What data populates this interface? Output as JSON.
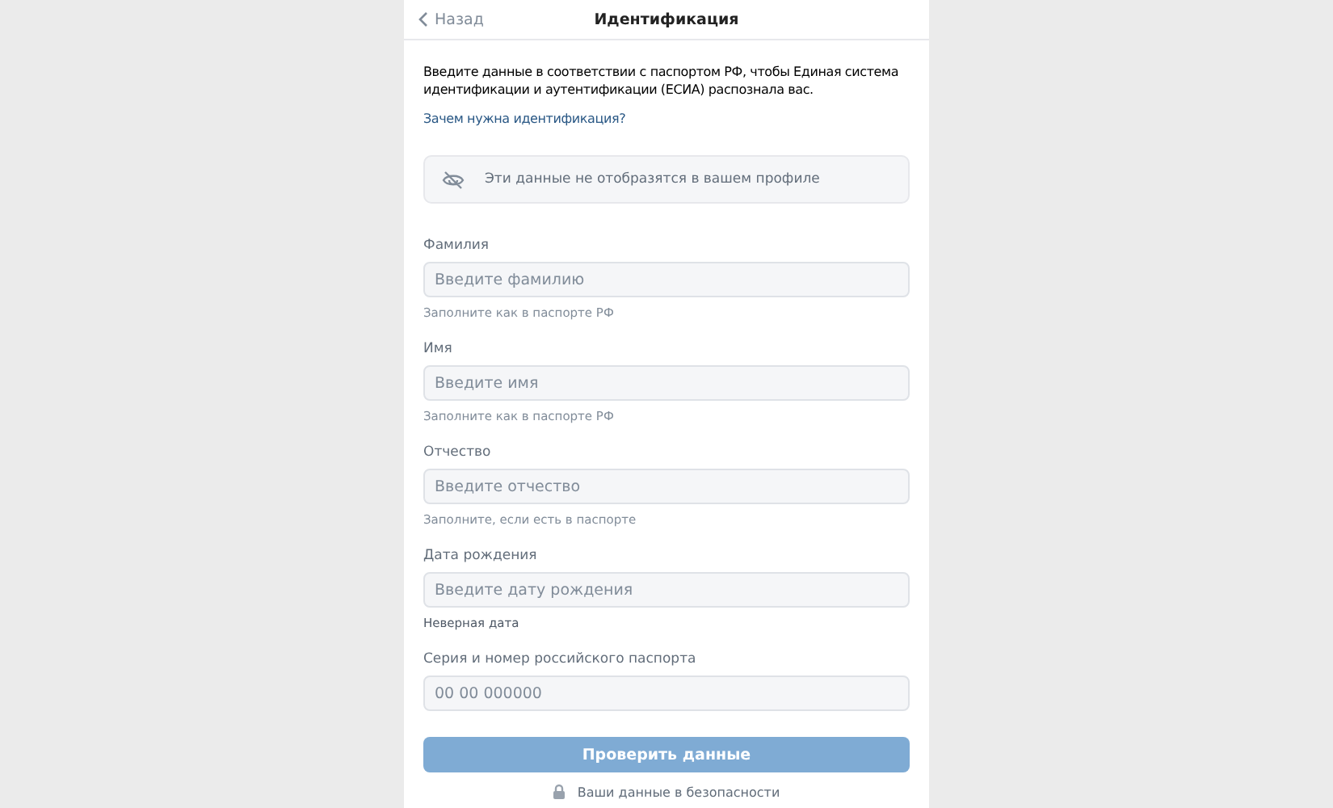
{
  "header": {
    "back": "Назад",
    "title": "Идентификация"
  },
  "intro": {
    "text": "Введите данные в соответствии с паспортом РФ, чтобы Единая система идентификации и аутентификации (ЕСИА) распознала вас.",
    "link": "Зачем нужна идентификация?"
  },
  "notice": {
    "text": "Эти данные не отобразятся в вашем профиле"
  },
  "fields": [
    {
      "label": "Фамилия",
      "placeholder": "Введите фамилию",
      "hint": "Заполните как в паспорте РФ",
      "error": false
    },
    {
      "label": "Имя",
      "placeholder": "Введите имя",
      "hint": "Заполните как в паспорте РФ",
      "error": false
    },
    {
      "label": "Отчество",
      "placeholder": "Введите отчество",
      "hint": "Заполните, если есть в паспорте",
      "error": false
    },
    {
      "label": "Дата рождения",
      "placeholder": "Введите дату рождения",
      "hint": "Неверная дата",
      "error": true
    },
    {
      "label": "Серия и номер российского паспорта",
      "placeholder": "00 00 000000"
    }
  ],
  "submit": {
    "label": "Проверить данные",
    "disabled": true
  },
  "footer": {
    "text": "Ваши данные в безопасности"
  }
}
